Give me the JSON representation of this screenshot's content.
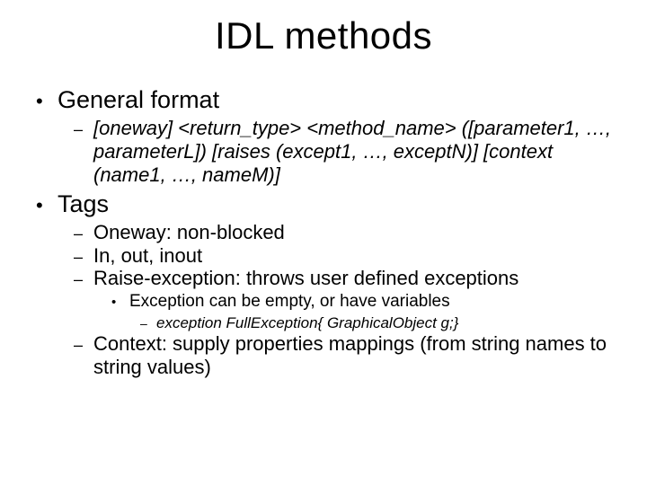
{
  "title": "IDL methods",
  "sections": {
    "s1": {
      "heading": "General format",
      "sub1": "[oneway] <return_type> <method_name> ([parameter1, …, parameterL]) [raises (except1, …, exceptN)] [context (name1, …, nameM)]"
    },
    "s2": {
      "heading": "Tags",
      "sub1": "Oneway: non-blocked",
      "sub2": "In, out, inout",
      "sub3": "Raise-exception: throws user defined exceptions",
      "sub3_a": "Exception can be empty, or have variables",
      "sub3_a_i": "exception FullException{ GraphicalObject g;}",
      "sub4": "Context: supply properties mappings (from string names to string values)"
    }
  }
}
